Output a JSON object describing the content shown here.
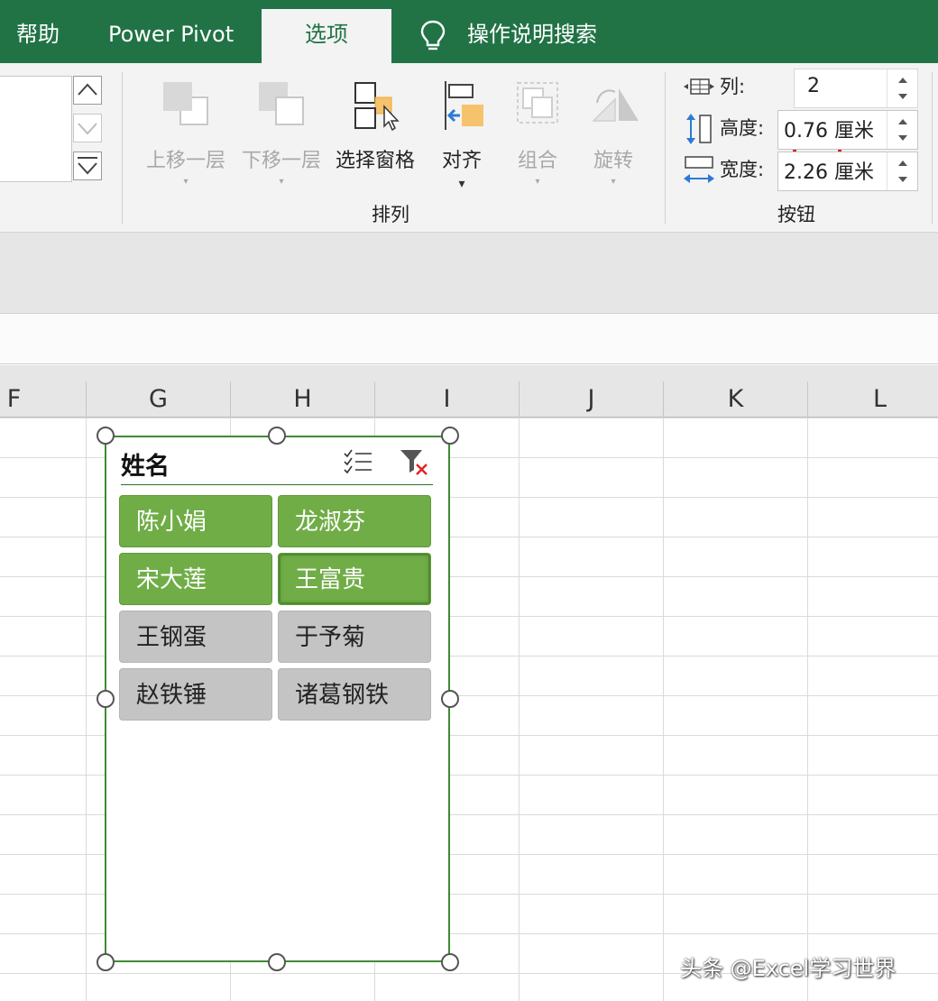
{
  "tabs": {
    "help": "帮助",
    "power_pivot": "Power Pivot",
    "options": "选项",
    "tell_me": "操作说明搜索"
  },
  "arrange": {
    "bring_forward": "上移一层",
    "send_backward": "下移一层",
    "selection_pane": "选择窗格",
    "align": "对齐",
    "group": "组合",
    "rotate": "旋转",
    "group_label": "排列"
  },
  "buttons": {
    "columns_label": "列:",
    "columns_value": "2",
    "height_label": "高度:",
    "height_value": "0.76 厘米",
    "width_label": "宽度:",
    "width_value": "2.26 厘米",
    "group_label": "按钮"
  },
  "columns": [
    "F",
    "G",
    "H",
    "I",
    "J",
    "K",
    "L"
  ],
  "slicer": {
    "title": "姓名",
    "items": [
      {
        "label": "陈小娟",
        "selected": true
      },
      {
        "label": "龙淑芬",
        "selected": true
      },
      {
        "label": "宋大莲",
        "selected": true
      },
      {
        "label": "王富贵",
        "selected": true
      },
      {
        "label": "王钢蛋",
        "selected": false
      },
      {
        "label": "于予菊",
        "selected": false
      },
      {
        "label": "赵铁锤",
        "selected": false
      },
      {
        "label": "诸葛钢铁",
        "selected": false
      }
    ]
  },
  "watermark": "头条 @Excel学习世界",
  "colors": {
    "ribbon_green": "#217346",
    "selected_item": "#70ad47",
    "unselected_item": "#c4c4c4",
    "highlight": "#e01414"
  }
}
